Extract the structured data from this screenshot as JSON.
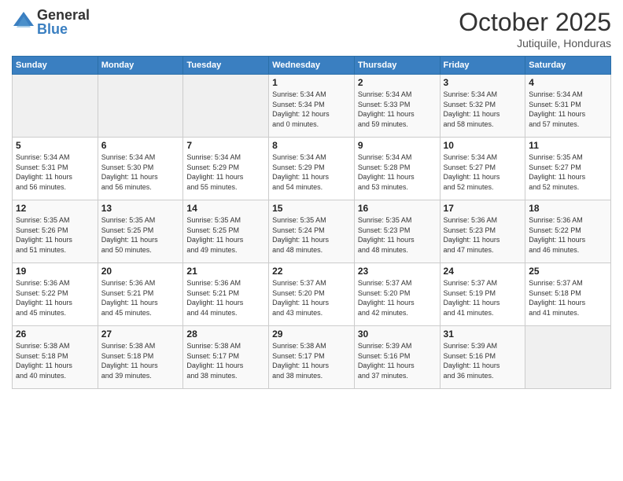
{
  "header": {
    "logo_general": "General",
    "logo_blue": "Blue",
    "month_title": "October 2025",
    "location": "Jutiquile, Honduras"
  },
  "weekdays": [
    "Sunday",
    "Monday",
    "Tuesday",
    "Wednesday",
    "Thursday",
    "Friday",
    "Saturday"
  ],
  "weeks": [
    [
      {
        "day": "",
        "info": ""
      },
      {
        "day": "",
        "info": ""
      },
      {
        "day": "",
        "info": ""
      },
      {
        "day": "1",
        "info": "Sunrise: 5:34 AM\nSunset: 5:34 PM\nDaylight: 12 hours\nand 0 minutes."
      },
      {
        "day": "2",
        "info": "Sunrise: 5:34 AM\nSunset: 5:33 PM\nDaylight: 11 hours\nand 59 minutes."
      },
      {
        "day": "3",
        "info": "Sunrise: 5:34 AM\nSunset: 5:32 PM\nDaylight: 11 hours\nand 58 minutes."
      },
      {
        "day": "4",
        "info": "Sunrise: 5:34 AM\nSunset: 5:31 PM\nDaylight: 11 hours\nand 57 minutes."
      }
    ],
    [
      {
        "day": "5",
        "info": "Sunrise: 5:34 AM\nSunset: 5:31 PM\nDaylight: 11 hours\nand 56 minutes."
      },
      {
        "day": "6",
        "info": "Sunrise: 5:34 AM\nSunset: 5:30 PM\nDaylight: 11 hours\nand 56 minutes."
      },
      {
        "day": "7",
        "info": "Sunrise: 5:34 AM\nSunset: 5:29 PM\nDaylight: 11 hours\nand 55 minutes."
      },
      {
        "day": "8",
        "info": "Sunrise: 5:34 AM\nSunset: 5:29 PM\nDaylight: 11 hours\nand 54 minutes."
      },
      {
        "day": "9",
        "info": "Sunrise: 5:34 AM\nSunset: 5:28 PM\nDaylight: 11 hours\nand 53 minutes."
      },
      {
        "day": "10",
        "info": "Sunrise: 5:34 AM\nSunset: 5:27 PM\nDaylight: 11 hours\nand 52 minutes."
      },
      {
        "day": "11",
        "info": "Sunrise: 5:35 AM\nSunset: 5:27 PM\nDaylight: 11 hours\nand 52 minutes."
      }
    ],
    [
      {
        "day": "12",
        "info": "Sunrise: 5:35 AM\nSunset: 5:26 PM\nDaylight: 11 hours\nand 51 minutes."
      },
      {
        "day": "13",
        "info": "Sunrise: 5:35 AM\nSunset: 5:25 PM\nDaylight: 11 hours\nand 50 minutes."
      },
      {
        "day": "14",
        "info": "Sunrise: 5:35 AM\nSunset: 5:25 PM\nDaylight: 11 hours\nand 49 minutes."
      },
      {
        "day": "15",
        "info": "Sunrise: 5:35 AM\nSunset: 5:24 PM\nDaylight: 11 hours\nand 48 minutes."
      },
      {
        "day": "16",
        "info": "Sunrise: 5:35 AM\nSunset: 5:23 PM\nDaylight: 11 hours\nand 48 minutes."
      },
      {
        "day": "17",
        "info": "Sunrise: 5:36 AM\nSunset: 5:23 PM\nDaylight: 11 hours\nand 47 minutes."
      },
      {
        "day": "18",
        "info": "Sunrise: 5:36 AM\nSunset: 5:22 PM\nDaylight: 11 hours\nand 46 minutes."
      }
    ],
    [
      {
        "day": "19",
        "info": "Sunrise: 5:36 AM\nSunset: 5:22 PM\nDaylight: 11 hours\nand 45 minutes."
      },
      {
        "day": "20",
        "info": "Sunrise: 5:36 AM\nSunset: 5:21 PM\nDaylight: 11 hours\nand 45 minutes."
      },
      {
        "day": "21",
        "info": "Sunrise: 5:36 AM\nSunset: 5:21 PM\nDaylight: 11 hours\nand 44 minutes."
      },
      {
        "day": "22",
        "info": "Sunrise: 5:37 AM\nSunset: 5:20 PM\nDaylight: 11 hours\nand 43 minutes."
      },
      {
        "day": "23",
        "info": "Sunrise: 5:37 AM\nSunset: 5:20 PM\nDaylight: 11 hours\nand 42 minutes."
      },
      {
        "day": "24",
        "info": "Sunrise: 5:37 AM\nSunset: 5:19 PM\nDaylight: 11 hours\nand 41 minutes."
      },
      {
        "day": "25",
        "info": "Sunrise: 5:37 AM\nSunset: 5:18 PM\nDaylight: 11 hours\nand 41 minutes."
      }
    ],
    [
      {
        "day": "26",
        "info": "Sunrise: 5:38 AM\nSunset: 5:18 PM\nDaylight: 11 hours\nand 40 minutes."
      },
      {
        "day": "27",
        "info": "Sunrise: 5:38 AM\nSunset: 5:18 PM\nDaylight: 11 hours\nand 39 minutes."
      },
      {
        "day": "28",
        "info": "Sunrise: 5:38 AM\nSunset: 5:17 PM\nDaylight: 11 hours\nand 38 minutes."
      },
      {
        "day": "29",
        "info": "Sunrise: 5:38 AM\nSunset: 5:17 PM\nDaylight: 11 hours\nand 38 minutes."
      },
      {
        "day": "30",
        "info": "Sunrise: 5:39 AM\nSunset: 5:16 PM\nDaylight: 11 hours\nand 37 minutes."
      },
      {
        "day": "31",
        "info": "Sunrise: 5:39 AM\nSunset: 5:16 PM\nDaylight: 11 hours\nand 36 minutes."
      },
      {
        "day": "",
        "info": ""
      }
    ]
  ]
}
